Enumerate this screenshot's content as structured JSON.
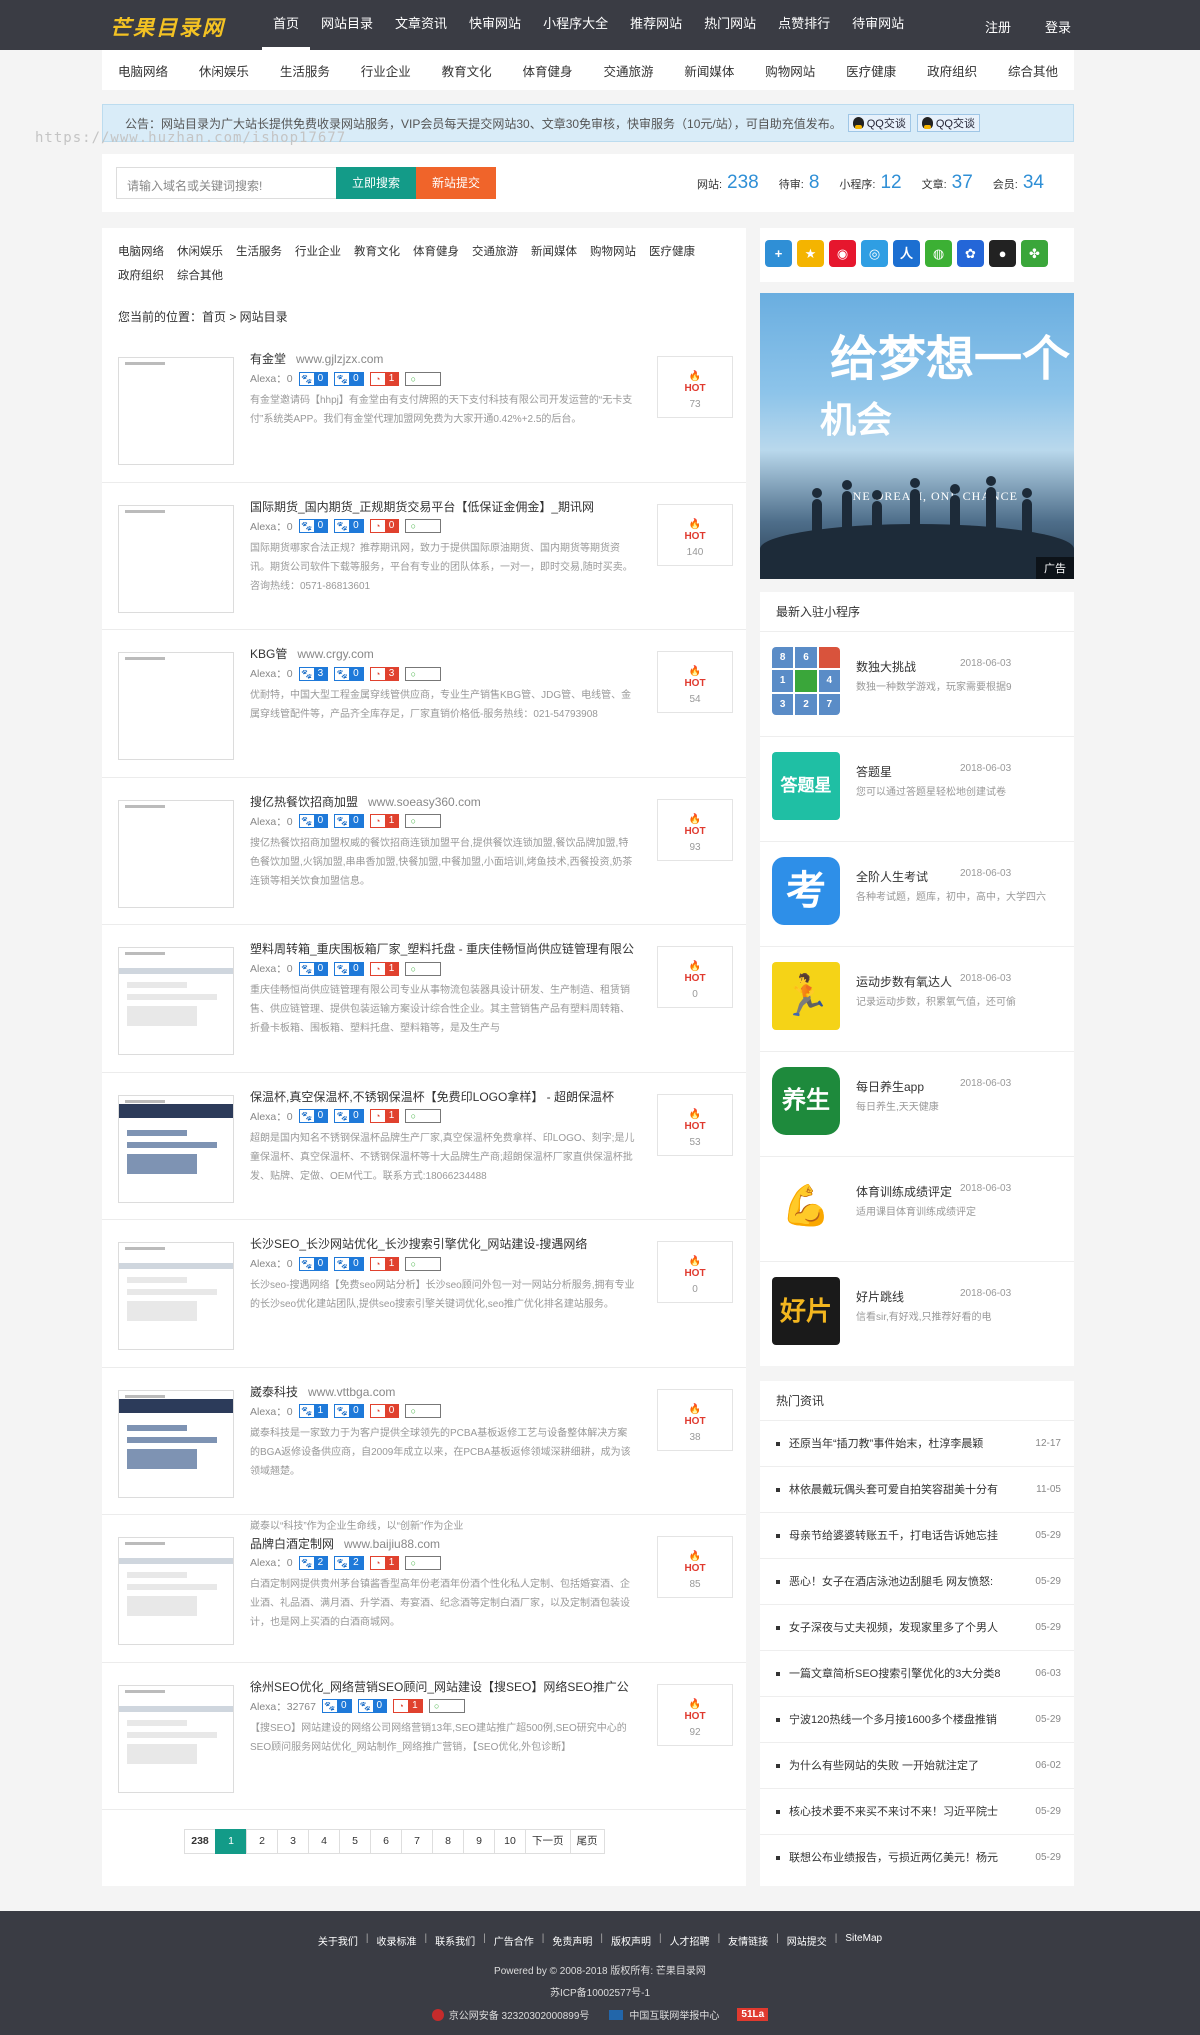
{
  "header": {
    "logo": "芒果目录网",
    "nav": [
      "首页",
      "网站目录",
      "文章资讯",
      "快审网站",
      "小程序大全",
      "推荐网站",
      "热门网站",
      "点赞排行",
      "待审网站"
    ],
    "register": "注册",
    "login": "登录"
  },
  "categories": [
    "电脑网络",
    "休闲娱乐",
    "生活服务",
    "行业企业",
    "教育文化",
    "体育健身",
    "交通旅游",
    "新闻媒体",
    "购物网站",
    "医疗健康",
    "政府组织",
    "综合其他"
  ],
  "notice": {
    "text": "公告：网站目录为广大站长提供免费收录网站服务，VIP会员每天提交网站30、文章30免审核，快审服务（10元/站），可自助充值发布。",
    "qq1": "QQ交谈",
    "qq2": "QQ交谈"
  },
  "watermark": "https://www.huzhan.com/ishop17677",
  "search": {
    "placeholder": "请输入域名或关键词搜索!",
    "search_btn": "立即搜索",
    "submit_btn": "新站提交"
  },
  "stats": [
    {
      "label": "网站:",
      "value": "238"
    },
    {
      "label": "待审:",
      "value": "8"
    },
    {
      "label": "小程序:",
      "value": "12"
    },
    {
      "label": "文章:",
      "value": "37"
    },
    {
      "label": "会员:",
      "value": "34"
    }
  ],
  "subcats": [
    "电脑网络",
    "休闲娱乐",
    "生活服务",
    "行业企业",
    "教育文化",
    "体育健身",
    "交通旅游",
    "新闻媒体",
    "购物网站",
    "医疗健康",
    "政府组织",
    "综合其他"
  ],
  "breadcrumb": "您当前的位置：首页 > 网站目录",
  "sites": [
    {
      "title": "有金堂",
      "domain": "www.gjlzjzx.com",
      "alexa": "Alexa：0",
      "b1": "0",
      "b2": "0",
      "b3": "1",
      "desc": "有金堂邀请码【hhpj】有金堂由有支付牌照的天下支付科技有限公司开发运营的“无卡支付”系统类APP。我们有金堂代理加盟网免费为大家开通0.42%+2.5的后台。",
      "hot": "73"
    },
    {
      "title": "国际期货_国内期货_正规期货交易平台【低保证金佣金】_期讯网",
      "domain": "",
      "alexa": "Alexa：0",
      "b1": "0",
      "b2": "0",
      "b3": "0",
      "desc": "国际期货哪家合法正规？推荐期讯网，致力于提供国际原油期货、国内期货等期货资讯。期货公司软件下载等服务，平台有专业的团队体系，一对一，即时交易,随时买卖。咨询热线：0571-86813601",
      "hot": "140"
    },
    {
      "title": "KBG管",
      "domain": "www.crgy.com",
      "alexa": "Alexa：0",
      "b1": "3",
      "b2": "0",
      "b3": "3",
      "desc": "优耐特，中国大型工程金属穿线管供应商，专业生产销售KBG管、JDG管、电线管、金属穿线管配件等，产品齐全库存足，厂家直销价格低-服务热线：021-54793908",
      "hot": "54"
    },
    {
      "title": "搜亿热餐饮招商加盟",
      "domain": "www.soeasy360.com",
      "alexa": "Alexa：0",
      "b1": "0",
      "b2": "0",
      "b3": "1",
      "desc": "搜亿热餐饮招商加盟权威的餐饮招商连锁加盟平台,提供餐饮连锁加盟,餐饮品牌加盟,特色餐饮加盟,火锅加盟,串串香加盟,快餐加盟,中餐加盟,小面培训,烤鱼技术,西餐投资,奶茶连锁等相关饮食加盟信息。",
      "hot": "93"
    },
    {
      "title": "塑料周转箱_重庆围板箱厂家_塑料托盘 - 重庆佳畅恒尚供应链管理有限公",
      "domain": "",
      "alexa": "Alexa：0",
      "b1": "0",
      "b2": "0",
      "b3": "1",
      "desc": "重庆佳畅恒尚供应链管理有限公司专业从事物流包装器具设计研发、生产制造、租赁销售、供应链管理、提供包装运输方案设计综合性企业。其主营销售产品有塑料周转箱、折叠卡板箱、围板箱、塑料托盘、塑料箱等，是及生产与",
      "hot": "0"
    },
    {
      "title": "保温杯,真空保温杯,不锈钢保温杯【免费印LOGO拿样】 - 超朗保温杯",
      "domain": "",
      "alexa": "Alexa：0",
      "b1": "0",
      "b2": "0",
      "b3": "1",
      "desc": "超朗是国内知名不锈钢保温杯品牌生产厂家,真空保温杯免费拿样、印LOGO、刻字;是儿童保温杯、真空保温杯、不锈钢保温杯等十大品牌生产商;超朗保温杯厂家直供保温杯批发、贴牌、定做、OEM代工。联系方式:18066234488",
      "hot": "53"
    },
    {
      "title": "长沙SEO_长沙网站优化_长沙搜索引擎优化_网站建设-搜遇网络",
      "domain": "",
      "alexa": "Alexa：0",
      "b1": "0",
      "b2": "0",
      "b3": "1",
      "desc": "长沙seo-搜遇网络【免费seo网站分析】长沙seo顾问外包一对一网站分析服务,拥有专业的长沙seo优化建站团队,提供seo搜索引擎关键词优化,seo推广优化排名建站服务。",
      "hot": "0"
    },
    {
      "title": "崴泰科技",
      "domain": "www.vttbga.com",
      "alexa": "Alexa：0",
      "b1": "1",
      "b2": "0",
      "b3": "0",
      "desc": "崴泰科技是一家致力于为客户提供全球领先的PCBA基板返修工艺与设备整体解决方案的BGA返修设备供应商，自2009年成立以来，在PCBA基板返修领域深耕细耕，成为该领域翘楚。",
      "hot": "38"
    },
    {
      "title": "品牌白酒定制网",
      "domain": "www.baijiu88.com",
      "alexa": "Alexa：0",
      "b1": "2",
      "b2": "2",
      "b3": "1",
      "desc": "白酒定制网提供贵州茅台镇酱香型高年份老酒年份酒个性化私人定制、包括婚宴酒、企业酒、礼品酒、满月酒、升学酒、寿宴酒、纪念酒等定制白酒厂家，以及定制酒包装设计，也是网上买酒的白酒商城网。",
      "hot": "85",
      "overlay": "崴泰以“科技”作为企业生命线，以“创新”作为企业"
    },
    {
      "title": "徐州SEO优化_网络营销SEO顾问_网站建设【搜SEO】网络SEO推广公",
      "domain": "",
      "alexa": "Alexa：32767",
      "b1": "0",
      "b2": "0",
      "b3": "1",
      "desc": "【搜SEO】网站建设的网络公司网络营销13年,SEO建站推广超500例,SEO研究中心的SEO顾问服务网站优化_网站制作_网络推广营销，【SEO优化,外包诊断】",
      "hot": "92"
    }
  ],
  "pager": [
    "238",
    "1",
    "2",
    "3",
    "4",
    "5",
    "6",
    "7",
    "8",
    "9",
    "10",
    "下一页",
    "尾页"
  ],
  "share_icons": [
    "plus-share-icon",
    "qzone-icon",
    "weibo-icon",
    "tencent-weibo-icon",
    "renren-icon",
    "wechat-icon",
    "baidu-icon",
    "qq-icon",
    "kaixin-icon"
  ],
  "ad": {
    "line1": "给梦想一个",
    "line2": "机会",
    "en": "ONE DREAM, ONE CHANCE",
    "tag": "广告"
  },
  "mini": {
    "title": "最新入驻小程序",
    "items": [
      {
        "name": "数独大挑战",
        "date": "2018-06-03",
        "sub": "数独一种数学游戏，玩家需要根据9"
      },
      {
        "name": "答题星",
        "date": "2018-06-03",
        "sub": "您可以通过答题星轻松地创建试卷"
      },
      {
        "name": "全阶人生考试",
        "date": "2018-06-03",
        "sub": "各种考试题，题库，初中，高中，大学四六"
      },
      {
        "name": "运动步数有氧达人",
        "date": "2018-06-03",
        "sub": "记录运动步数，积累氧气值，还可偷"
      },
      {
        "name": "每日养生app",
        "date": "2018-06-03",
        "sub": "每日养生,天天健康"
      },
      {
        "name": "体育训练成绩评定",
        "date": "2018-06-03",
        "sub": "适用课目体育训练成绩评定"
      },
      {
        "name": "好片跳线",
        "date": "2018-06-03",
        "sub": "信看sir,有好戏,只推荐好看的电"
      }
    ]
  },
  "news": {
    "title": "热门资讯",
    "items": [
      {
        "t": "还原当年“插刀教”事件始末，杜淳李晨颖",
        "d": "12-17"
      },
      {
        "t": "林依晨戴玩偶头套可爱自拍笑容甜美十分有",
        "d": "11-05"
      },
      {
        "t": "母亲节给婆婆转账五千，打电话告诉她忘挂",
        "d": "05-29"
      },
      {
        "t": "恶心！女子在酒店泳池边刮腿毛 网友愤怒:",
        "d": "05-29"
      },
      {
        "t": "女子深夜与丈夫视频，发现家里多了个男人",
        "d": "05-29"
      },
      {
        "t": "一篇文章简析SEO搜索引擎优化的3大分类8",
        "d": "06-03"
      },
      {
        "t": "宁波120热线一个多月接1600多个楼盘推销",
        "d": "05-29"
      },
      {
        "t": "为什么有些网站的失败 一开始就注定了",
        "d": "06-02"
      },
      {
        "t": "核心技术要不来买不来讨不来！习近平院士",
        "d": "05-29"
      },
      {
        "t": "联想公布业绩报告，亏损近两亿美元！杨元",
        "d": "05-29"
      }
    ]
  },
  "footer": {
    "links": [
      "关于我们",
      "收录标准",
      "联系我们",
      "广告合作",
      "免责声明",
      "版权声明",
      "人才招聘",
      "友情链接",
      "网站提交",
      "SiteMap"
    ],
    "powered": "Powered by © 2008-2018 版权所有: 芒果目录网",
    "icp": "苏ICP备10002577号-1",
    "police": "京公网安备 32320302000899号",
    "cnnic": "中国互联网举报中心",
    "badge": "51La"
  }
}
